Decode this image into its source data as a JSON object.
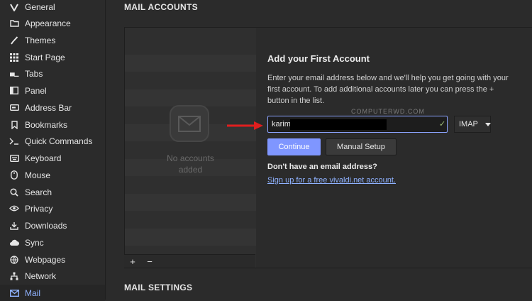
{
  "sidebar": {
    "items": [
      {
        "label": "General",
        "icon": "vivaldi-icon"
      },
      {
        "label": "Appearance",
        "icon": "folder-icon"
      },
      {
        "label": "Themes",
        "icon": "brush-icon"
      },
      {
        "label": "Start Page",
        "icon": "grid-icon"
      },
      {
        "label": "Tabs",
        "icon": "tabs-icon"
      },
      {
        "label": "Panel",
        "icon": "panel-icon"
      },
      {
        "label": "Address Bar",
        "icon": "address-bar-icon"
      },
      {
        "label": "Bookmarks",
        "icon": "bookmark-icon"
      },
      {
        "label": "Quick Commands",
        "icon": "quick-commands-icon"
      },
      {
        "label": "Keyboard",
        "icon": "keyboard-icon"
      },
      {
        "label": "Mouse",
        "icon": "mouse-icon"
      },
      {
        "label": "Search",
        "icon": "search-icon"
      },
      {
        "label": "Privacy",
        "icon": "eye-icon"
      },
      {
        "label": "Downloads",
        "icon": "download-icon"
      },
      {
        "label": "Sync",
        "icon": "sync-icon"
      },
      {
        "label": "Webpages",
        "icon": "globe-icon"
      },
      {
        "label": "Network",
        "icon": "network-icon"
      },
      {
        "label": "Mail",
        "icon": "mail-icon",
        "active": true
      }
    ]
  },
  "mail_accounts": {
    "title": "MAIL ACCOUNTS",
    "empty_line1": "No accounts",
    "empty_line2": "added",
    "add_button": "+",
    "remove_button": "−"
  },
  "detail": {
    "title": "Add your First Account",
    "description": "Enter your email address below and we'll help you get going with your first account. To add additional accounts later you can press the + button in the list.",
    "watermark": "COMPUTERWD.COM",
    "email_value": "karim",
    "protocol": "IMAP",
    "continue_label": "Continue",
    "manual_setup_label": "Manual Setup",
    "no_email_text": "Don't have an email address?",
    "signup_link": "Sign up for a free vivaldi.net account."
  },
  "mail_settings": {
    "title": "MAIL SETTINGS"
  },
  "colors": {
    "accent": "#8fb2ff",
    "primary_button": "#7f96ff",
    "arrow": "#e01e1e"
  }
}
